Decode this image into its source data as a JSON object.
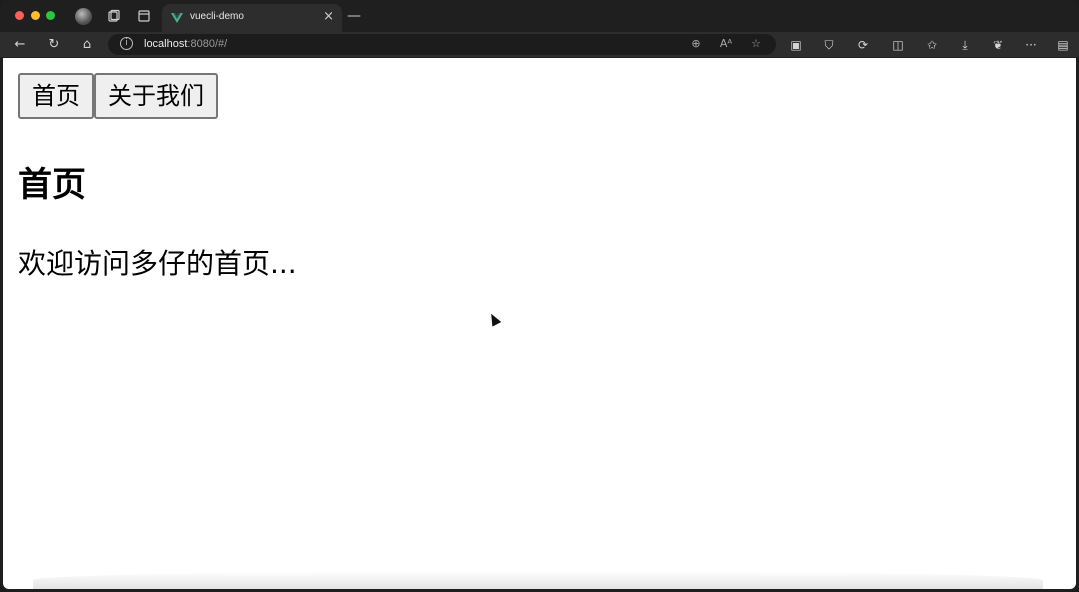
{
  "browser": {
    "tab": {
      "title": "vuecli-demo",
      "close_icon": "×"
    },
    "new_tab_icon": "—",
    "address": {
      "host": "localhost",
      "rest": ":8080/#/"
    },
    "nav_icons": {
      "back": "←",
      "reload": "↻",
      "home": "⌂"
    },
    "omnibox_icons": {
      "zoom": "⊕",
      "read_aloud": "Aᴬ",
      "favorite": "☆"
    },
    "ext_icons": {
      "extension1": "▣",
      "shield": "⛉",
      "sync": "⟳",
      "split": "◫",
      "favorites": "✩",
      "downloads": "⤓",
      "copilot": "❦",
      "more": "···",
      "sidebar": "▤"
    }
  },
  "page": {
    "buttons": {
      "home": "首页",
      "about": "关于我们"
    },
    "heading": "首页",
    "welcome": "欢迎访问多仔的首页..."
  }
}
